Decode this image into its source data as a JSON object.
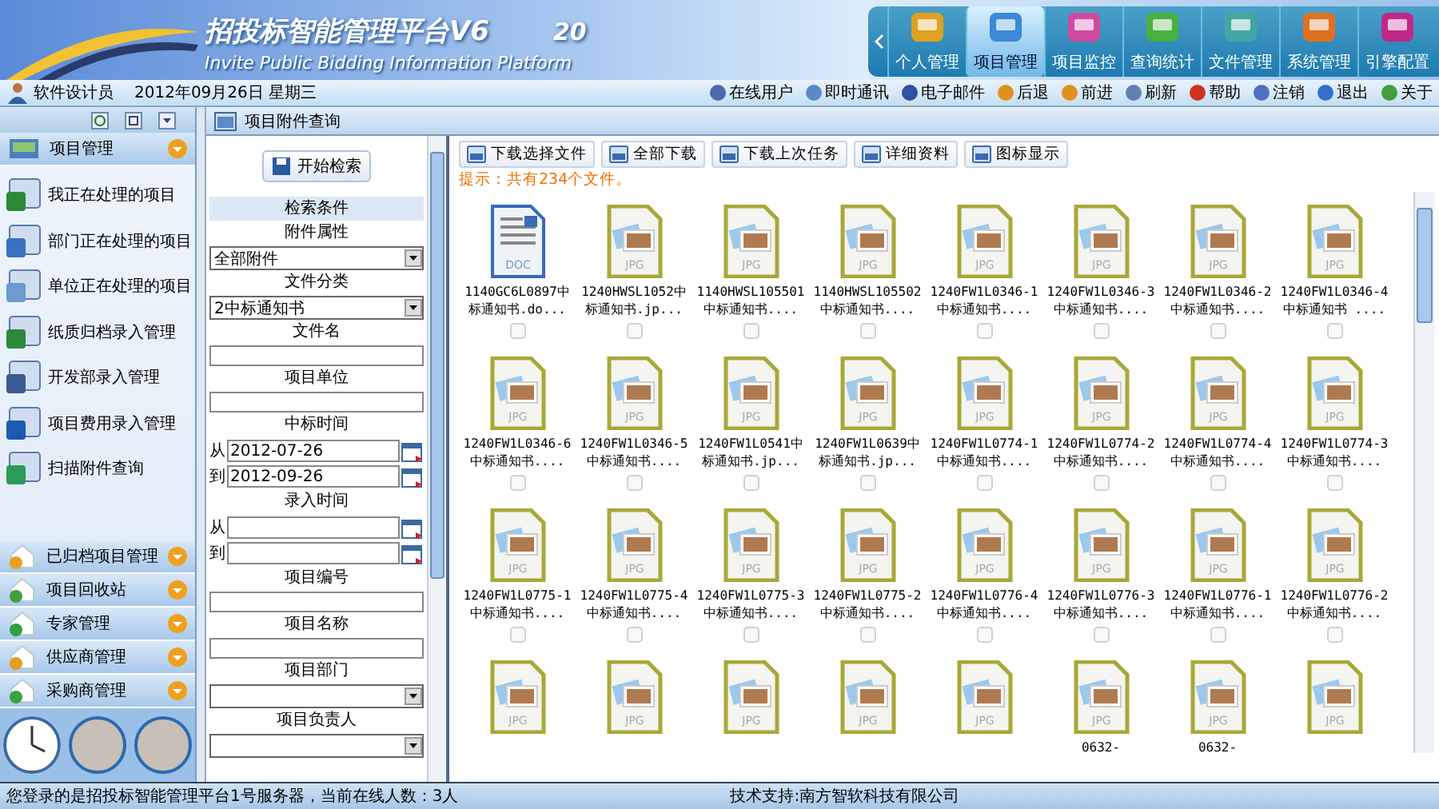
{
  "header": {
    "title": "招投标智能管理平台V6",
    "title_fragment": "20",
    "subtitle": "Invite Public Bidding Information Platform"
  },
  "nav_tabs": [
    {
      "label": "个人管理",
      "selected": false,
      "color": "#e0a020"
    },
    {
      "label": "项目管理",
      "selected": true,
      "color": "#3a8ad8"
    },
    {
      "label": "项目监控",
      "selected": false,
      "color": "#d04aa0"
    },
    {
      "label": "查询统计",
      "selected": false,
      "color": "#48b040"
    },
    {
      "label": "文件管理",
      "selected": false,
      "color": "#40a8a0"
    },
    {
      "label": "系统管理",
      "selected": false,
      "color": "#e07020"
    },
    {
      "label": "引擎配置",
      "selected": false,
      "color": "#c02888"
    }
  ],
  "info_bar": {
    "user": "软件设计员",
    "date": "2012年09月26日  星期三",
    "links": [
      {
        "label": "在线用户",
        "color": "#4a6aa8"
      },
      {
        "label": "即时通讯",
        "color": "#5a8ac8"
      },
      {
        "label": "电子邮件",
        "color": "#3050a0"
      },
      {
        "label": "后退",
        "color": "#e09020"
      },
      {
        "label": "前进",
        "color": "#e09020"
      },
      {
        "label": "刷新",
        "color": "#6080b0"
      },
      {
        "label": "帮助",
        "color": "#d03020"
      },
      {
        "label": "注销",
        "color": "#5070c0"
      },
      {
        "label": "退出",
        "color": "#3070d0"
      },
      {
        "label": "关于",
        "color": "#40a040"
      }
    ]
  },
  "sidebar": {
    "main_group": "项目管理",
    "items": [
      {
        "label": "我正在处理的项目",
        "color": "#2a8a3a"
      },
      {
        "label": "部门正在处理的项目",
        "color": "#3a70c0"
      },
      {
        "label": "单位正在处理的项目",
        "color": "#6a9ad0"
      },
      {
        "label": "纸质归档录入管理",
        "color": "#2a8a3a"
      },
      {
        "label": "开发部录入管理",
        "color": "#3a5a90"
      },
      {
        "label": "项目费用录入管理",
        "color": "#1a5ab0"
      },
      {
        "label": "扫描附件查询",
        "color": "#2a9a5a"
      }
    ],
    "groups": [
      {
        "label": "已归档项目管理",
        "color": "#e8a020"
      },
      {
        "label": "项目回收站",
        "color": "#40a040"
      },
      {
        "label": "专家管理",
        "color": "#30a040"
      },
      {
        "label": "供应商管理",
        "color": "#e0a020"
      },
      {
        "label": "采购商管理",
        "color": "#3aa040"
      }
    ]
  },
  "panel_title": "项目附件查询",
  "search": {
    "button": "开始检索",
    "fields": [
      {
        "kind": "heading",
        "text": "检索条件"
      },
      {
        "kind": "label",
        "text": "附件属性"
      },
      {
        "kind": "select",
        "value": "全部附件"
      },
      {
        "kind": "label",
        "text": "文件分类"
      },
      {
        "kind": "select",
        "value": "2中标通知书"
      },
      {
        "kind": "label",
        "text": "文件名"
      },
      {
        "kind": "text"
      },
      {
        "kind": "label",
        "text": "项目单位"
      },
      {
        "kind": "text"
      },
      {
        "kind": "label",
        "text": "中标时间"
      },
      {
        "kind": "date",
        "prefix": "从",
        "value": "2012-07-26"
      },
      {
        "kind": "date",
        "prefix": "到",
        "value": "2012-09-26"
      },
      {
        "kind": "label",
        "text": "录入时间"
      },
      {
        "kind": "date",
        "prefix": "从"
      },
      {
        "kind": "date",
        "prefix": "到"
      },
      {
        "kind": "label",
        "text": "项目编号"
      },
      {
        "kind": "text"
      },
      {
        "kind": "label",
        "text": "项目名称"
      },
      {
        "kind": "text"
      },
      {
        "kind": "label",
        "text": "项目部门"
      },
      {
        "kind": "select"
      },
      {
        "kind": "label",
        "text": "项目负责人"
      },
      {
        "kind": "select"
      }
    ]
  },
  "toolbar": [
    "下载选择文件",
    "全部下载",
    "下载上次任务",
    "详细资料",
    "图标显示"
  ],
  "hint": "提示：共有234个文件。",
  "files": [
    {
      "kind": "doc",
      "type_label": "DOC",
      "name": "1140GC6L0897中标通知书.do...",
      "checked": false
    },
    {
      "kind": "jpg",
      "type_label": "JPG",
      "name": "1240HWSL1052中标通知书.jp...",
      "checked": false
    },
    {
      "kind": "jpg",
      "type_label": "JPG",
      "name": "1140HWSL105501中标通知书....",
      "checked": false
    },
    {
      "kind": "jpg",
      "type_label": "JPG",
      "name": "1140HWSL105502中标通知书....",
      "checked": false
    },
    {
      "kind": "jpg",
      "type_label": "JPG",
      "name": "1240FW1L0346-1中标通知书....",
      "checked": false
    },
    {
      "kind": "jpg",
      "type_label": "JPG",
      "name": "1240FW1L0346-3中标通知书....",
      "checked": false
    },
    {
      "kind": "jpg",
      "type_label": "JPG",
      "name": "1240FW1L0346-2中标通知书....",
      "checked": false
    },
    {
      "kind": "jpg",
      "type_label": "JPG",
      "name": "1240FW1L0346-4中标通知书 ....",
      "checked": false
    },
    {
      "kind": "jpg",
      "type_label": "JPG",
      "name": "1240FW1L0346-6中标通知书....",
      "checked": false
    },
    {
      "kind": "jpg",
      "type_label": "JPG",
      "name": "1240FW1L0346-5中标通知书....",
      "checked": false
    },
    {
      "kind": "jpg",
      "type_label": "JPG",
      "name": "1240FW1L0541中标通知书.jp...",
      "checked": false
    },
    {
      "kind": "jpg",
      "type_label": "JPG",
      "name": "1240FW1L0639中标通知书.jp...",
      "checked": false
    },
    {
      "kind": "jpg",
      "type_label": "JPG",
      "name": "1240FW1L0774-1中标通知书....",
      "checked": false
    },
    {
      "kind": "jpg",
      "type_label": "JPG",
      "name": "1240FW1L0774-2中标通知书....",
      "checked": false
    },
    {
      "kind": "jpg",
      "type_label": "JPG",
      "name": "1240FW1L0774-4中标通知书....",
      "checked": false
    },
    {
      "kind": "jpg",
      "type_label": "JPG",
      "name": "1240FW1L0774-3中标通知书....",
      "checked": false
    },
    {
      "kind": "jpg",
      "type_label": "JPG",
      "name": "1240FW1L0775-1中标通知书....",
      "checked": false
    },
    {
      "kind": "jpg",
      "type_label": "JPG",
      "name": "1240FW1L0775-4中标通知书....",
      "checked": false
    },
    {
      "kind": "jpg",
      "type_label": "JPG",
      "name": "1240FW1L0775-3中标通知书....",
      "checked": false
    },
    {
      "kind": "jpg",
      "type_label": "JPG",
      "name": "1240FW1L0775-2中标通知书....",
      "checked": false
    },
    {
      "kind": "jpg",
      "type_label": "JPG",
      "name": "1240FW1L0776-4中标通知书....",
      "checked": false
    },
    {
      "kind": "jpg",
      "type_label": "JPG",
      "name": "1240FW1L0776-3中标通知书....",
      "checked": false
    },
    {
      "kind": "jpg",
      "type_label": "JPG",
      "name": "1240FW1L0776-1中标通知书....",
      "checked": false
    },
    {
      "kind": "jpg",
      "type_label": "JPG",
      "name": "1240FW1L0776-2中标通知书....",
      "checked": false
    },
    {
      "kind": "jpg",
      "type_label": "JPG"
    },
    {
      "kind": "jpg",
      "type_label": "JPG"
    },
    {
      "kind": "jpg",
      "type_label": "JPG"
    },
    {
      "kind": "jpg",
      "type_label": "JPG"
    },
    {
      "kind": "jpg",
      "type_label": "JPG"
    },
    {
      "kind": "jpg",
      "type_label": "JPG",
      "name": "0632-"
    },
    {
      "kind": "jpg",
      "type_label": "JPG",
      "name": "0632-"
    },
    {
      "kind": "jpg",
      "type_label": "JPG"
    }
  ],
  "status_bar": {
    "left": "您登录的是招投标智能管理平台1号服务器，当前在线人数：3人",
    "right": "技术支持:南方智软科技有限公司"
  }
}
